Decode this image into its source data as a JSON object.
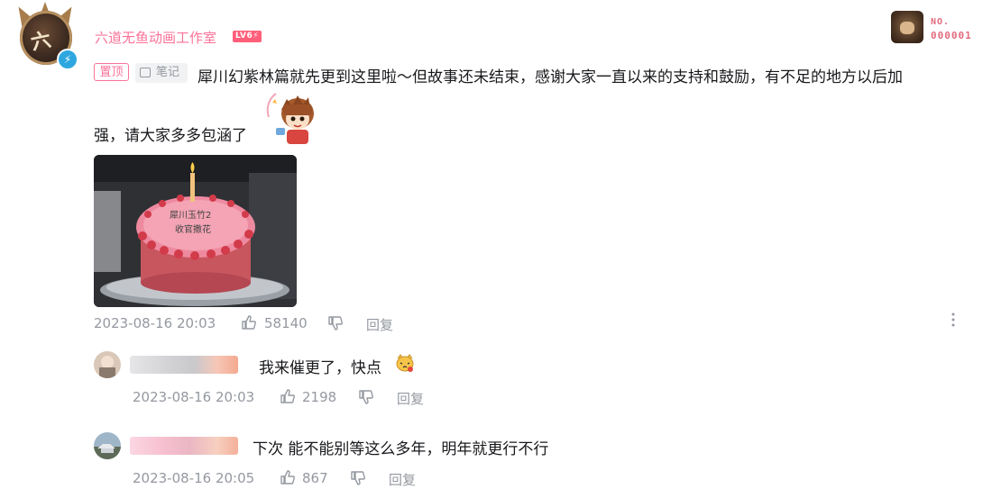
{
  "comment": {
    "username": "六道无鱼动画工作室",
    "level_badge": "LV6⚡",
    "fan_badge": {
      "label": "NO.",
      "number": "000001"
    },
    "pin_tag": "置顶",
    "note_tag": "笔记",
    "text_line1": "犀川幻紫林篇就先更到这里啦～但故事还未结束，感谢大家一直以来的支持和鼓励，有不足的地方以后加",
    "text_line2": "强，请大家多多包涵了",
    "cake_text_line1": "犀川玉竹2",
    "cake_text_line2": "收官撒花",
    "timestamp": "2023-08-16 20:03",
    "likes": "58140",
    "reply_label": "回复",
    "more_icon": "more-vertical-icon"
  },
  "replies": [
    {
      "text": "我来催更了，快点",
      "emoji": "cat-emoji",
      "timestamp": "2023-08-16 20:03",
      "likes": "2198",
      "reply_label": "回复"
    },
    {
      "text": "下次  能不能别等这么多年，明年就更行不行",
      "timestamp": "2023-08-16 20:05",
      "likes": "867",
      "reply_label": "回复"
    }
  ],
  "colors": {
    "accent_pink": "#fb7299",
    "meta_gray": "#9499a0",
    "text": "#18191c"
  }
}
